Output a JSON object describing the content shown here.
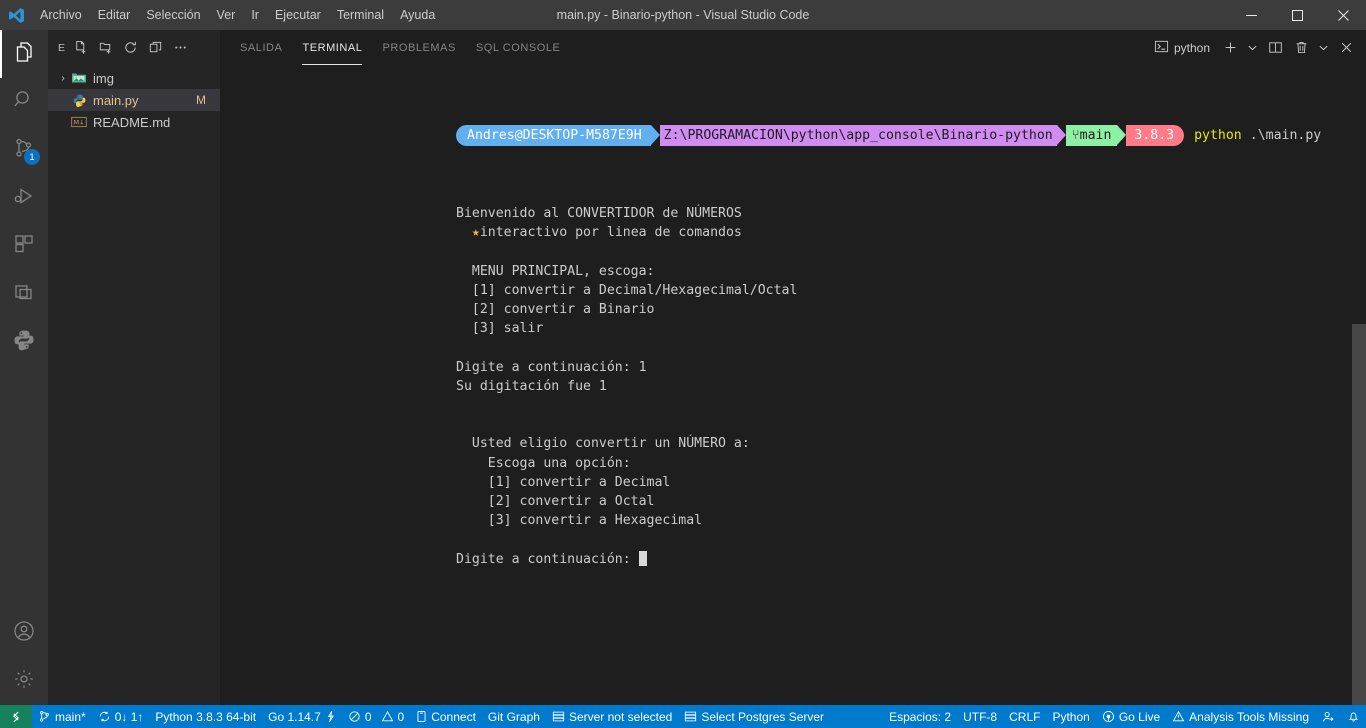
{
  "titlebar": {
    "logo_icon": "vscode-logo-icon",
    "menus": [
      "Archivo",
      "Editar",
      "Selección",
      "Ver",
      "Ir",
      "Ejecutar",
      "Terminal",
      "Ayuda"
    ],
    "window_title": "main.py - Binario-python - Visual Studio Code",
    "controls": [
      {
        "name": "minimize-button",
        "icon": "minimize-icon"
      },
      {
        "name": "maximize-button",
        "icon": "maximize-icon"
      },
      {
        "name": "close-button",
        "icon": "close-icon"
      }
    ]
  },
  "activitybar": {
    "items": [
      {
        "name": "sidebar-item-explorer",
        "icon": "files-icon",
        "active": true,
        "badge": ""
      },
      {
        "name": "sidebar-item-search",
        "icon": "search-icon",
        "active": false,
        "badge": ""
      },
      {
        "name": "sidebar-item-source-control",
        "icon": "source-control-icon",
        "active": false,
        "badge": "1"
      },
      {
        "name": "sidebar-item-run-debug",
        "icon": "run-and-debug-icon",
        "active": false,
        "badge": ""
      },
      {
        "name": "sidebar-item-extensions",
        "icon": "extensions-icon",
        "active": false,
        "badge": ""
      },
      {
        "name": "sidebar-item-remote-explorer",
        "icon": "remote-explorer-icon",
        "active": false,
        "badge": ""
      },
      {
        "name": "sidebar-item-python",
        "icon": "python-icon",
        "active": false,
        "badge": ""
      }
    ],
    "bottom": [
      {
        "name": "accounts-button",
        "icon": "account-icon"
      },
      {
        "name": "manage-settings-button",
        "icon": "gear-icon"
      }
    ]
  },
  "sidebar": {
    "title": "E",
    "actions": [
      {
        "name": "new-file-button",
        "icon": "new-file-icon"
      },
      {
        "name": "new-folder-button",
        "icon": "new-folder-icon"
      },
      {
        "name": "refresh-explorer-button",
        "icon": "refresh-icon"
      },
      {
        "name": "collapse-folders-button",
        "icon": "collapse-all-icon"
      },
      {
        "name": "explorer-more-actions-button",
        "icon": "ellipsis-icon"
      }
    ],
    "files": [
      {
        "name": "img",
        "type": "folder",
        "icon": "image-folder-icon",
        "twisty": "›",
        "badge": "",
        "selected": false
      },
      {
        "name": "main.py",
        "type": "file",
        "icon": "python-file-icon",
        "twisty": "",
        "badge": "M",
        "selected": true
      },
      {
        "name": "README.md",
        "type": "file",
        "icon": "markdown-file-icon",
        "twisty": "",
        "badge": "",
        "selected": false
      }
    ]
  },
  "panel": {
    "tabs": [
      {
        "label": "SALIDA",
        "active": false
      },
      {
        "label": "TERMINAL",
        "active": true
      },
      {
        "label": "PROBLEMAS",
        "active": false
      },
      {
        "label": "SQL CONSOLE",
        "active": false
      }
    ],
    "terminal_selector": {
      "icon": "terminal-icon",
      "label": "python"
    },
    "actions": [
      {
        "name": "new-terminal-button",
        "icon": "plus-icon",
        "label": "+"
      },
      {
        "name": "new-terminal-dropdown-button",
        "icon": "chevron-down-icon",
        "label": "⌄"
      },
      {
        "name": "split-terminal-button",
        "icon": "split-editor-icon",
        "label": ""
      },
      {
        "name": "kill-terminal-button",
        "icon": "trash-icon",
        "label": ""
      },
      {
        "name": "panel-views-dropdown-button",
        "icon": "chevron-down-icon",
        "label": "⌄"
      },
      {
        "name": "close-panel-button",
        "icon": "close-icon",
        "label": "✕"
      }
    ]
  },
  "terminal": {
    "prompt": {
      "user": "Andres@DESKTOP-M587E9H",
      "path": "Z:\\PROGRAMACION\\python\\app_console\\Binario-python",
      "branch_symbol": "⑂",
      "branch": "main",
      "version": "3.8.3",
      "command": "python",
      "command_arg": ".\\main.py"
    },
    "lines": [
      "Bienvenido al CONVERTIDOR de NÚMEROS",
      "  ★interactivo por linea de comandos",
      "",
      "  MENU PRINCIPAL, escoga:",
      "  [1] convertir a Decimal/Hexagecimal/Octal",
      "  [2] convertir a Binario",
      "  [3] salir",
      "",
      "Digite a continuación: 1",
      "Su digitación fue 1",
      "",
      "",
      "  Usted eligio convertir un NÚMERO a:",
      "    Escoga una opción:",
      "    [1] convertir a Decimal",
      "    [2] convertir a Octal",
      "    [3] convertir a Hexagecimal",
      "",
      "Digite a continuación: "
    ],
    "star_line_index": 1,
    "cursor_line_index": 18
  },
  "statusbar": {
    "left": [
      {
        "name": "remote-host-button",
        "icon": "remote-icon",
        "label": "",
        "remote": true
      },
      {
        "name": "branch-status-button",
        "icon": "source-control-icon",
        "label": "main*"
      },
      {
        "name": "sync-changes-button",
        "icon": "sync-icon",
        "label": "0↓ 1↑"
      },
      {
        "name": "python-interpreter-button",
        "icon": "",
        "label": "Python 3.8.3 64-bit"
      },
      {
        "name": "go-version-button",
        "icon": "go-icon",
        "label": "Go 1.14.7"
      },
      {
        "name": "problems-status-button",
        "icon": "error-warning-icon",
        "label": "0  0"
      },
      {
        "name": "connect-button",
        "icon": "database-icon",
        "label": "Connect"
      },
      {
        "name": "git-graph-button",
        "icon": "",
        "label": "Git Graph"
      },
      {
        "name": "server-status-button",
        "icon": "server-icon",
        "label": "Server not selected"
      },
      {
        "name": "select-postgres-server-button",
        "icon": "server-icon",
        "label": "Select Postgres Server"
      }
    ],
    "right": [
      {
        "name": "indentation-button",
        "icon": "",
        "label": "Espacios: 2"
      },
      {
        "name": "encoding-button",
        "icon": "",
        "label": "UTF-8"
      },
      {
        "name": "eol-button",
        "icon": "",
        "label": "CRLF"
      },
      {
        "name": "language-mode-button",
        "icon": "",
        "label": "Python"
      },
      {
        "name": "go-live-button",
        "icon": "broadcast-icon",
        "label": "Go Live"
      },
      {
        "name": "analysis-tools-button",
        "icon": "warning-icon",
        "label": "Analysis Tools Missing"
      },
      {
        "name": "live-share-button",
        "icon": "live-share-icon",
        "label": ""
      },
      {
        "name": "notifications-button",
        "icon": "bell-icon",
        "label": ""
      }
    ]
  },
  "colors": {
    "accent": "#007acc",
    "titlebar_bg": "#3c3c3c",
    "activitybar_bg": "#333333",
    "sidebar_bg": "#252526",
    "editor_bg": "#1e1e1e",
    "remote_green": "#16825d",
    "prompt_user": "#61afef",
    "prompt_path": "#d08cf0",
    "prompt_branch": "#8ef0a4",
    "prompt_version": "#ff7b87",
    "command_yellow": "#e5e510",
    "modified_badge": "#e2c08d"
  }
}
